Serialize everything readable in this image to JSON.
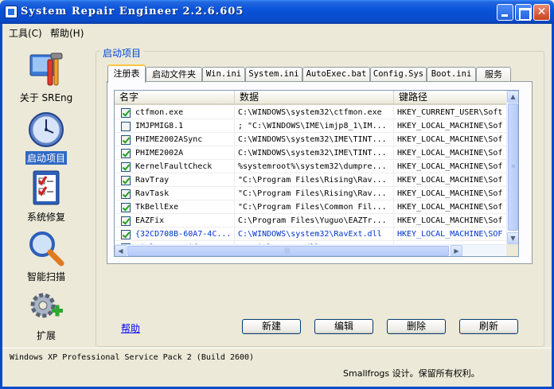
{
  "window": {
    "title": "System Repair Engineer 2.2.6.605"
  },
  "menu": [
    {
      "label": "工具(C)"
    },
    {
      "label": "帮助(H)"
    }
  ],
  "nav": [
    {
      "label": "关于 SREng",
      "icon": "toolbox-icon"
    },
    {
      "label": "启动项目",
      "icon": "clock-icon",
      "selected": true
    },
    {
      "label": "系统修复",
      "icon": "checklist-icon"
    },
    {
      "label": "智能扫描",
      "icon": "magnifier-icon"
    },
    {
      "label": "扩展",
      "icon": "gears-plus-icon"
    }
  ],
  "group_title": "启动项目",
  "tabs": [
    "注册表",
    "启动文件夹",
    "Win.ini",
    "System.ini",
    "AutoExec.bat",
    "Config.Sys",
    "Boot.ini",
    "服务"
  ],
  "list": {
    "columns": [
      "名字",
      "数据",
      "键路径"
    ],
    "rows": [
      {
        "checked": true,
        "name": "ctfmon.exe",
        "data": "C:\\WINDOWS\\system32\\ctfmon.exe",
        "path": "HKEY_CURRENT_USER\\Soft",
        "blue": false
      },
      {
        "checked": false,
        "name": "IMJPMIG8.1",
        "data": "; \"C:\\WINDOWS\\IME\\imjp8_1\\IM...",
        "path": "HKEY_LOCAL_MACHINE\\Sof",
        "blue": false
      },
      {
        "checked": true,
        "name": "PHIME2002ASync",
        "data": "C:\\WINDOWS\\system32\\IME\\TINT...",
        "path": "HKEY_LOCAL_MACHINE\\Sof",
        "blue": false
      },
      {
        "checked": true,
        "name": "PHIME2002A",
        "data": "C:\\WINDOWS\\system32\\IME\\TINT...",
        "path": "HKEY_LOCAL_MACHINE\\Sof",
        "blue": false
      },
      {
        "checked": true,
        "name": "KernelFaultCheck",
        "data": "%systemroot%\\system32\\dumpre...",
        "path": "HKEY_LOCAL_MACHINE\\Sof",
        "blue": false
      },
      {
        "checked": true,
        "name": "RavTray",
        "data": "\"C:\\Program Files\\Rising\\Rav...",
        "path": "HKEY_LOCAL_MACHINE\\Sof",
        "blue": false
      },
      {
        "checked": true,
        "name": "RavTask",
        "data": "\"C:\\Program Files\\Rising\\Rav...",
        "path": "HKEY_LOCAL_MACHINE\\Sof",
        "blue": false
      },
      {
        "checked": true,
        "name": "TkBellExe",
        "data": "\"C:\\Program Files\\Common Fil...",
        "path": "HKEY_LOCAL_MACHINE\\Sof",
        "blue": false
      },
      {
        "checked": true,
        "name": "EAZFix",
        "data": "C:\\Program Files\\Yuguo\\EAZTr...",
        "path": "HKEY_LOCAL_MACHINE\\Sof",
        "blue": false
      },
      {
        "checked": true,
        "name": "{32CD708B-60A7-4C...",
        "data": "C:\\WINDOWS\\system32\\RavExt.dll",
        "path": "HKEY_LOCAL_MACHINE\\SOF",
        "blue": true
      },
      {
        "checked": true,
        "name": "WinlogonNotify: S...",
        "data": "SSMWinlogonEx.dll",
        "path": "HKEY_LOCAL_MACHINE\\SOF",
        "blue": true
      }
    ]
  },
  "help_link": "帮助",
  "buttons": {
    "new": "新建",
    "edit": "编辑",
    "delete": "删除",
    "refresh": "刷新"
  },
  "status": {
    "os": "Windows XP Professional Service Pack 2 (Build 2600)",
    "copyright": "Smallfrogs 设计。保留所有权利。"
  }
}
